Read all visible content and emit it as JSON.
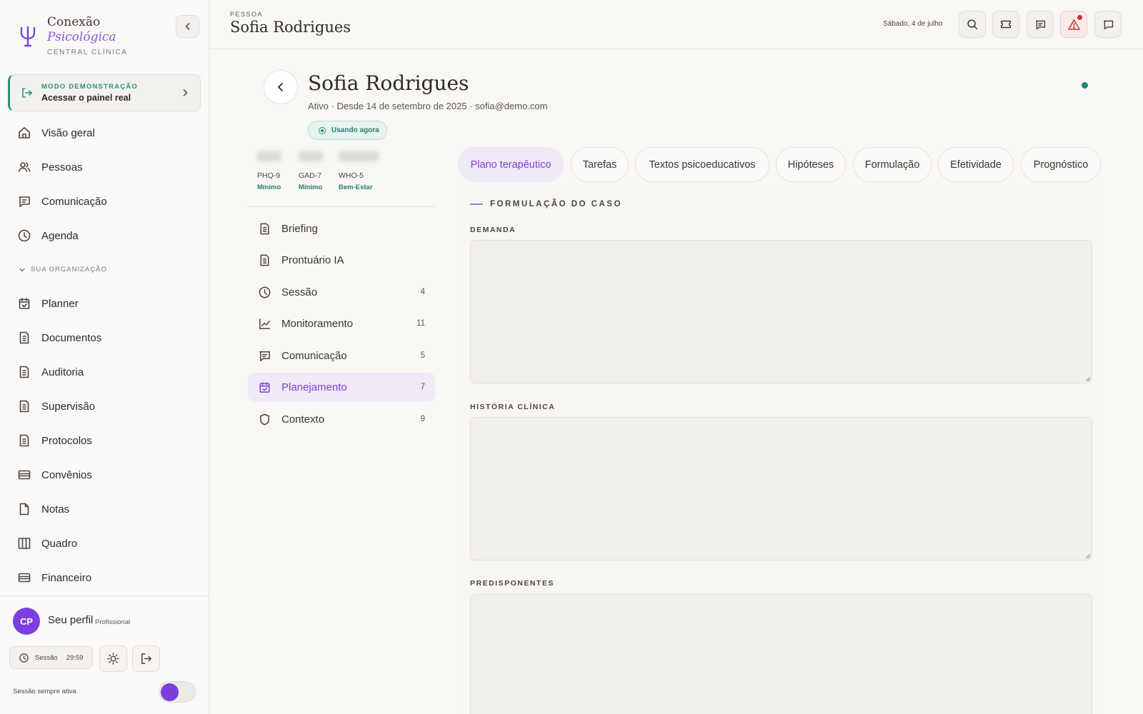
{
  "brand": {
    "name_line1": "Conexão",
    "name_line2": "Psicológica",
    "subtitle": "CENTRAL CLÍNICA"
  },
  "demo": {
    "label": "MODO DEMONSTRAÇÃO",
    "action": "Acessar o painel real"
  },
  "nav": {
    "items": [
      {
        "label": "Visão geral",
        "icon": "home-icon"
      },
      {
        "label": "Pessoas",
        "icon": "users-icon"
      },
      {
        "label": "Comunicação",
        "icon": "chat-icon"
      },
      {
        "label": "Agenda",
        "icon": "clock-icon"
      }
    ],
    "org_title": "SUA ORGANIZAÇÃO",
    "org_items": [
      {
        "label": "Planner",
        "icon": "calendar-check-icon"
      },
      {
        "label": "Documentos",
        "icon": "document-icon"
      },
      {
        "label": "Auditoria",
        "icon": "document-icon"
      },
      {
        "label": "Supervisão",
        "icon": "document-icon"
      },
      {
        "label": "Protocolos",
        "icon": "document-icon"
      },
      {
        "label": "Convênios",
        "icon": "card-icon"
      },
      {
        "label": "Notas",
        "icon": "file-icon"
      },
      {
        "label": "Quadro",
        "icon": "columns-icon"
      },
      {
        "label": "Financeiro",
        "icon": "card-icon"
      }
    ]
  },
  "profile": {
    "initials": "CP",
    "name": "Seu perfil",
    "role": "Profissional",
    "session_label": "Sessão",
    "session_time": "29:59",
    "always_active_label": "Sessão sempre ativa"
  },
  "header": {
    "kicker": "PESSOA",
    "title": "Sofia Rodrigues",
    "date": "Sábado, 4 de julho"
  },
  "person": {
    "name": "Sofia Rodrigues",
    "meta": "Ativo · Desde 14 de setembro de 2025 · sofia@demo.com",
    "badge": "Usando agora"
  },
  "scores": [
    {
      "name": "PHQ-9",
      "level": "Mínimo"
    },
    {
      "name": "GAD-7",
      "level": "Mínimo"
    },
    {
      "name": "WHO-5",
      "level": "Bem-Estar"
    }
  ],
  "subnav": [
    {
      "label": "Briefing",
      "count": ""
    },
    {
      "label": "Prontuário IA",
      "count": ""
    },
    {
      "label": "Sessão",
      "count": "4"
    },
    {
      "label": "Monitoramento",
      "count": "11"
    },
    {
      "label": "Comunicação",
      "count": "5"
    },
    {
      "label": "Planejamento",
      "count": "7"
    },
    {
      "label": "Contexto",
      "count": "9"
    }
  ],
  "tabs": [
    "Plano terapêutico",
    "Tarefas",
    "Textos psicoeducativos",
    "Hipóteses",
    "Formulação",
    "Efetividade",
    "Prognóstico"
  ],
  "formulation": {
    "section_title": "FORMULAÇÃO DO CASO",
    "fields": [
      {
        "label": "DEMANDA",
        "value": ""
      },
      {
        "label": "HISTÓRIA CLÍNICA",
        "value": ""
      },
      {
        "label": "PREDISPONENTES",
        "value": ""
      }
    ]
  },
  "colors": {
    "accent": "#7b3fe0",
    "teal": "#2f8f7e",
    "alert": "#d33131"
  }
}
